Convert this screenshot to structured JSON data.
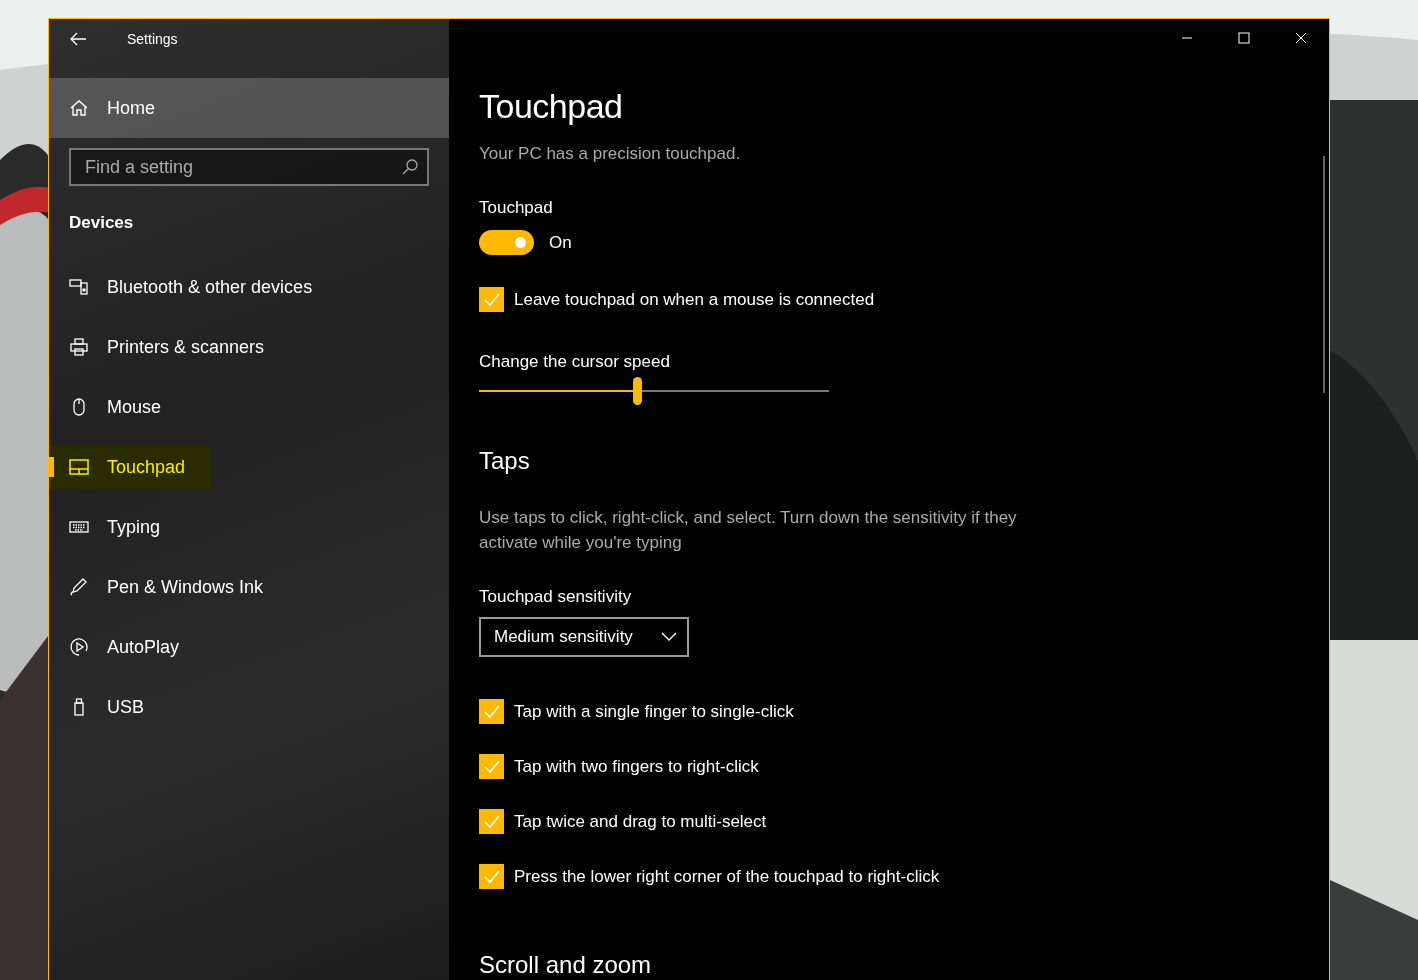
{
  "window": {
    "title": "Settings"
  },
  "sidebar": {
    "home": "Home",
    "search": {
      "placeholder": "Find a setting"
    },
    "section": "Devices",
    "items": [
      {
        "label": "Bluetooth & other devices",
        "selected": false
      },
      {
        "label": "Printers & scanners",
        "selected": false
      },
      {
        "label": "Mouse",
        "selected": false
      },
      {
        "label": "Touchpad",
        "selected": true
      },
      {
        "label": "Typing",
        "selected": false
      },
      {
        "label": "Pen & Windows Ink",
        "selected": false
      },
      {
        "label": "AutoPlay",
        "selected": false
      },
      {
        "label": "USB",
        "selected": false
      }
    ]
  },
  "main": {
    "title": "Touchpad",
    "subtitle": "Your PC has a precision touchpad.",
    "toggle": {
      "label": "Touchpad",
      "on": true,
      "state_text": "On"
    },
    "mouse_checkbox": {
      "label": "Leave touchpad on when a mouse is connected",
      "checked": true
    },
    "slider": {
      "label": "Change the cursor speed",
      "level": 0.45
    },
    "taps": {
      "heading": "Taps",
      "description": "Use taps to click, right-click, and select. Turn down the sensitivity if they activate while you're typing",
      "sensitivity": {
        "label": "Touchpad sensitivity",
        "value": "Medium sensitivity"
      },
      "checkboxes": [
        {
          "label": "Tap with a single finger to single-click",
          "checked": true
        },
        {
          "label": "Tap with two fingers to right-click",
          "checked": true
        },
        {
          "label": "Tap twice and drag to multi-select",
          "checked": true
        },
        {
          "label": "Press the lower right corner of the touchpad to right-click",
          "checked": true
        }
      ]
    },
    "next_heading": "Scroll and zoom"
  }
}
